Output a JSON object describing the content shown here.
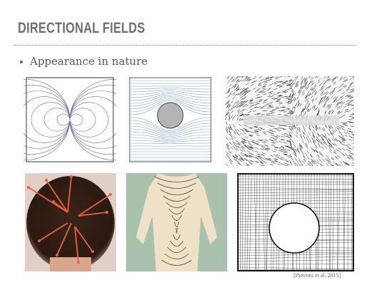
{
  "slide": {
    "title": "DIRECTIONAL FIELDS",
    "bullet": "Appearance in nature",
    "citation": "[Pietroni et al. 2015]"
  },
  "images": [
    {
      "name": "dipole-vector-field-plot"
    },
    {
      "name": "flow-around-cylinder-streamlines"
    },
    {
      "name": "magnet-iron-filings"
    },
    {
      "name": "hair-whorl-photo"
    },
    {
      "name": "body-hair-direction-drawing"
    },
    {
      "name": "quad-mesh-around-hole"
    }
  ],
  "colors": {
    "title": "#6f6f6f",
    "hair_arrows": "#e8603c",
    "cylinder": "#b5b3b6",
    "streamlines": "#7fa6c8"
  }
}
